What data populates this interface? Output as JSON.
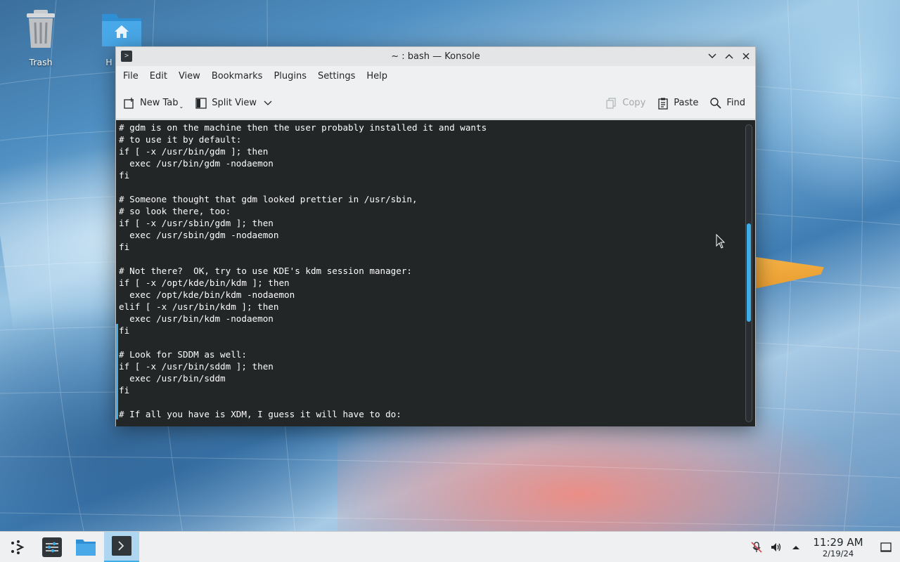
{
  "desktop": {
    "icons": [
      {
        "label": "Trash",
        "icon": "trash-icon"
      },
      {
        "label": "H",
        "icon": "home-folder-icon"
      }
    ]
  },
  "window": {
    "title": "~ : bash — Konsole",
    "menu": [
      "File",
      "Edit",
      "View",
      "Bookmarks",
      "Plugins",
      "Settings",
      "Help"
    ],
    "toolbar": {
      "new_tab": "New Tab",
      "split_view": "Split View",
      "copy": "Copy",
      "paste": "Paste",
      "find": "Find"
    }
  },
  "terminal": {
    "lines": [
      "# gdm is on the machine then the user probably installed it and wants",
      "# to use it by default:",
      "if [ -x /usr/bin/gdm ]; then",
      "  exec /usr/bin/gdm -nodaemon",
      "fi",
      "",
      "# Someone thought that gdm looked prettier in /usr/sbin,",
      "# so look there, too:",
      "if [ -x /usr/sbin/gdm ]; then",
      "  exec /usr/sbin/gdm -nodaemon",
      "fi",
      "",
      "# Not there?  OK, try to use KDE's kdm session manager:",
      "if [ -x /opt/kde/bin/kdm ]; then",
      "  exec /opt/kde/bin/kdm -nodaemon",
      "elif [ -x /usr/bin/kdm ]; then",
      "  exec /usr/bin/kdm -nodaemon",
      "fi",
      "",
      "# Look for SDDM as well:",
      "if [ -x /usr/bin/sddm ]; then",
      "  exec /usr/bin/sddm",
      "fi",
      "",
      "# If all you have is XDM, I guess it will have to do:"
    ]
  },
  "taskbar": {
    "time": "11:29 AM",
    "date": "2/19/24"
  },
  "colors": {
    "accent": "#3daee9",
    "terminal_bg": "#232627",
    "terminal_fg": "#fcfcfc"
  }
}
